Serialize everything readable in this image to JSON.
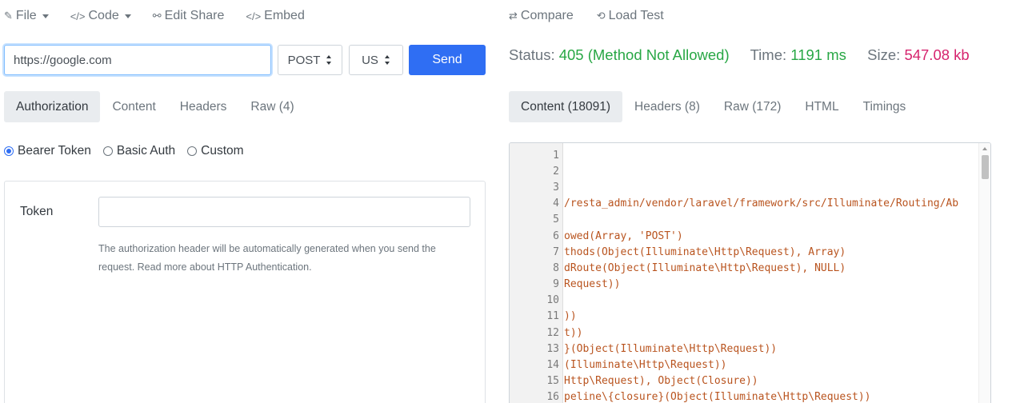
{
  "request": {
    "menu": [
      {
        "icon": "file-icon",
        "glyph": "✎",
        "label": "File",
        "dropdown": true
      },
      {
        "icon": "code-icon",
        "glyph": "</>",
        "label": "Code",
        "dropdown": true
      },
      {
        "icon": "share-icon",
        "glyph": "⚯",
        "label": "Edit Share",
        "dropdown": false
      },
      {
        "icon": "embed-icon",
        "glyph": "</>",
        "label": "Embed",
        "dropdown": false
      }
    ],
    "url": {
      "value": "https://google.com"
    },
    "method": "POST",
    "region": "US",
    "send_label": "Send",
    "tabs": [
      {
        "label": "Authorization",
        "active": true
      },
      {
        "label": "Content",
        "active": false
      },
      {
        "label": "Headers",
        "active": false
      },
      {
        "label": "Raw (4)",
        "active": false
      }
    ],
    "auth_types": [
      {
        "label": "Bearer Token",
        "checked": true
      },
      {
        "label": "Basic Auth",
        "checked": false
      },
      {
        "label": "Custom",
        "checked": false
      }
    ],
    "token": {
      "label": "Token",
      "value": "",
      "help": "The authorization header will be automatically generated when you send the request. Read more about HTTP Authentication."
    }
  },
  "response": {
    "menu": [
      {
        "icon": "compare-icon",
        "glyph": "⇄",
        "label": "Compare"
      },
      {
        "icon": "load-test-icon",
        "glyph": "⟲",
        "label": "Load Test"
      }
    ],
    "status": {
      "status_label": "Status:",
      "status_value": "405 (Method Not Allowed)",
      "time_label": "Time:",
      "time_value": "1191 ms",
      "size_label": "Size:",
      "size_value": "547.08 kb"
    },
    "colors": {
      "ok": "#28a745",
      "size": "#d6246e",
      "accent": "#2f6ef3"
    },
    "tabs": [
      {
        "label": "Content (18091)",
        "active": true
      },
      {
        "label": "Headers (8)",
        "active": false
      },
      {
        "label": "Raw (172)",
        "active": false
      },
      {
        "label": "HTML",
        "active": false
      },
      {
        "label": "Timings",
        "active": false
      }
    ],
    "code_lines": [
      {
        "n": "1",
        "text": ""
      },
      {
        "n": "2",
        "text": ""
      },
      {
        "n": "3",
        "text": ""
      },
      {
        "n": "4",
        "text": "/resta_admin/vendor/laravel/framework/src/Illuminate/Routing/Ab"
      },
      {
        "n": "5",
        "text": ""
      },
      {
        "n": "6",
        "text": "owed(Array, 'POST')"
      },
      {
        "n": "7",
        "text": "thods(Object(Illuminate\\Http\\Request), Array)"
      },
      {
        "n": "8",
        "text": "dRoute(Object(Illuminate\\Http\\Request), NULL)"
      },
      {
        "n": "9",
        "text": "Request))"
      },
      {
        "n": "10",
        "text": ""
      },
      {
        "n": "11",
        "text": "))"
      },
      {
        "n": "12",
        "text": "t))"
      },
      {
        "n": "13",
        "text": "}(Object(Illuminate\\Http\\Request))"
      },
      {
        "n": "14",
        "text": "(Illuminate\\Http\\Request))"
      },
      {
        "n": "15",
        "text": "Http\\Request), Object(Closure))"
      },
      {
        "n": "16",
        "text": "peline\\{closure}(Object(Illuminate\\Http\\Request))"
      }
    ]
  }
}
